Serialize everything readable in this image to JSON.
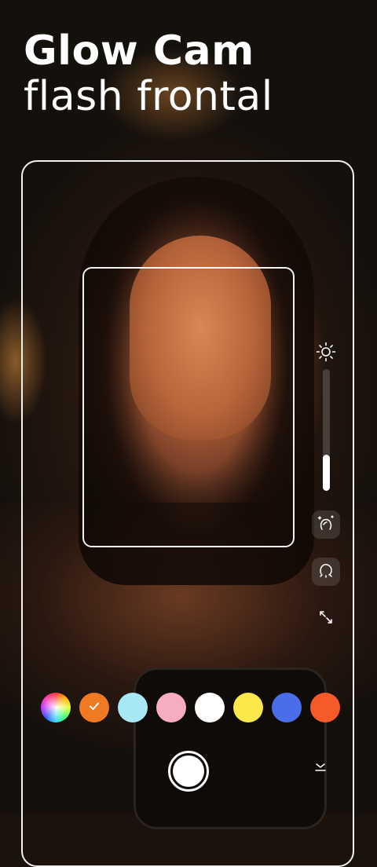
{
  "header": {
    "title_line1": "Glow Cam",
    "title_line2": "flash frontal"
  },
  "controls": {
    "brightness": {
      "icon": "sun-icon"
    },
    "light_level": {
      "fraction": 0.3
    },
    "face_retouch": {
      "icon": "face-sparkle-icon"
    },
    "face_shape": {
      "icon": "face-outline-icon"
    },
    "resize": {
      "icon": "expand-arrows-icon"
    }
  },
  "palette": {
    "selected_index": 1,
    "swatches": [
      {
        "name": "rainbow",
        "color": "multicolor"
      },
      {
        "name": "orange",
        "color": "#f07a24"
      },
      {
        "name": "light-blue",
        "color": "#a8e8f5"
      },
      {
        "name": "pink",
        "color": "#f6adc0"
      },
      {
        "name": "white",
        "color": "#ffffff"
      },
      {
        "name": "yellow",
        "color": "#fce84a"
      },
      {
        "name": "blue",
        "color": "#4a6ee8"
      },
      {
        "name": "red-orange",
        "color": "#f55a2a"
      }
    ]
  },
  "bottom": {
    "shutter": {
      "icon": "shutter-icon"
    },
    "collapse": {
      "icon": "chevron-down-icon"
    }
  }
}
